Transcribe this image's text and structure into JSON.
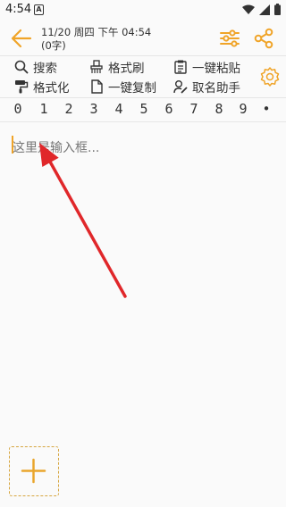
{
  "status_bar": {
    "time": "4:54",
    "notification_badge": "A"
  },
  "header": {
    "date": "11/20 周四 下午 04:54",
    "char_count": "(0字)",
    "accent_color": "#f0a428"
  },
  "toolbar": {
    "search": "搜索",
    "format_brush": "格式刷",
    "paste": "一键粘贴",
    "formatting": "格式化",
    "copy": "一键复制",
    "naming": "取名助手"
  },
  "number_keys": [
    "0",
    "1",
    "2",
    "3",
    "4",
    "5",
    "6",
    "7",
    "8",
    "9",
    "•"
  ],
  "editor": {
    "placeholder": "这里是输入框..."
  },
  "annotation": {
    "arrow_color": "#e0272a"
  }
}
